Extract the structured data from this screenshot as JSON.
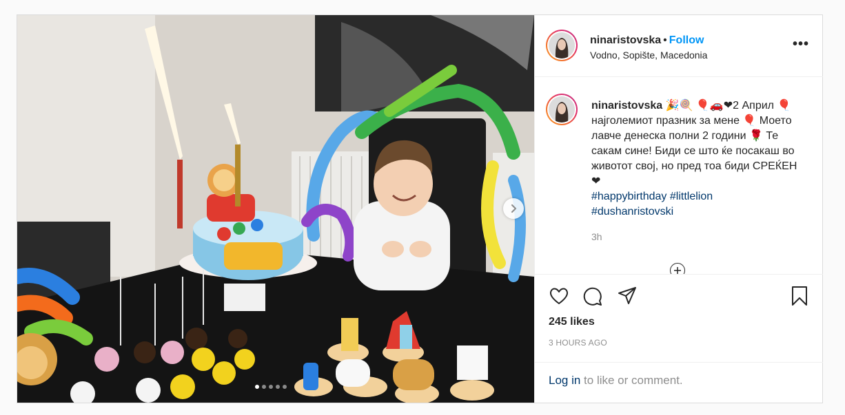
{
  "post": {
    "username": "ninaristovska",
    "separator": "•",
    "follow_label": "Follow",
    "location": "Vodno, Sopište, Macedonia",
    "more_label": "•••"
  },
  "caption": {
    "username": "ninaristovska",
    "text": " 🎉🍭 🎈🚗❤2 Април 🎈 најголемиот празник за мене 🎈 Моето лавче денеска полни 2 години 🌹 Те сакам сине! Биди се што ќе посакаш во животот свој, но пред тоа биди СРЕЌЕН❤",
    "hashtags": [
      "#happybirthday",
      "#littlelion",
      "#dushanristovski"
    ],
    "time": "3h"
  },
  "actions": {
    "likes": "245 likes",
    "time_ago": "3 HOURS AGO"
  },
  "login": {
    "link": "Log in",
    "rest": " to like or comment."
  },
  "carousel": {
    "slide_count": 5,
    "active_index": 0
  },
  "colors": {
    "link_blue": "#0095f6",
    "hashtag": "#00376b",
    "muted": "#8e8e8e"
  }
}
